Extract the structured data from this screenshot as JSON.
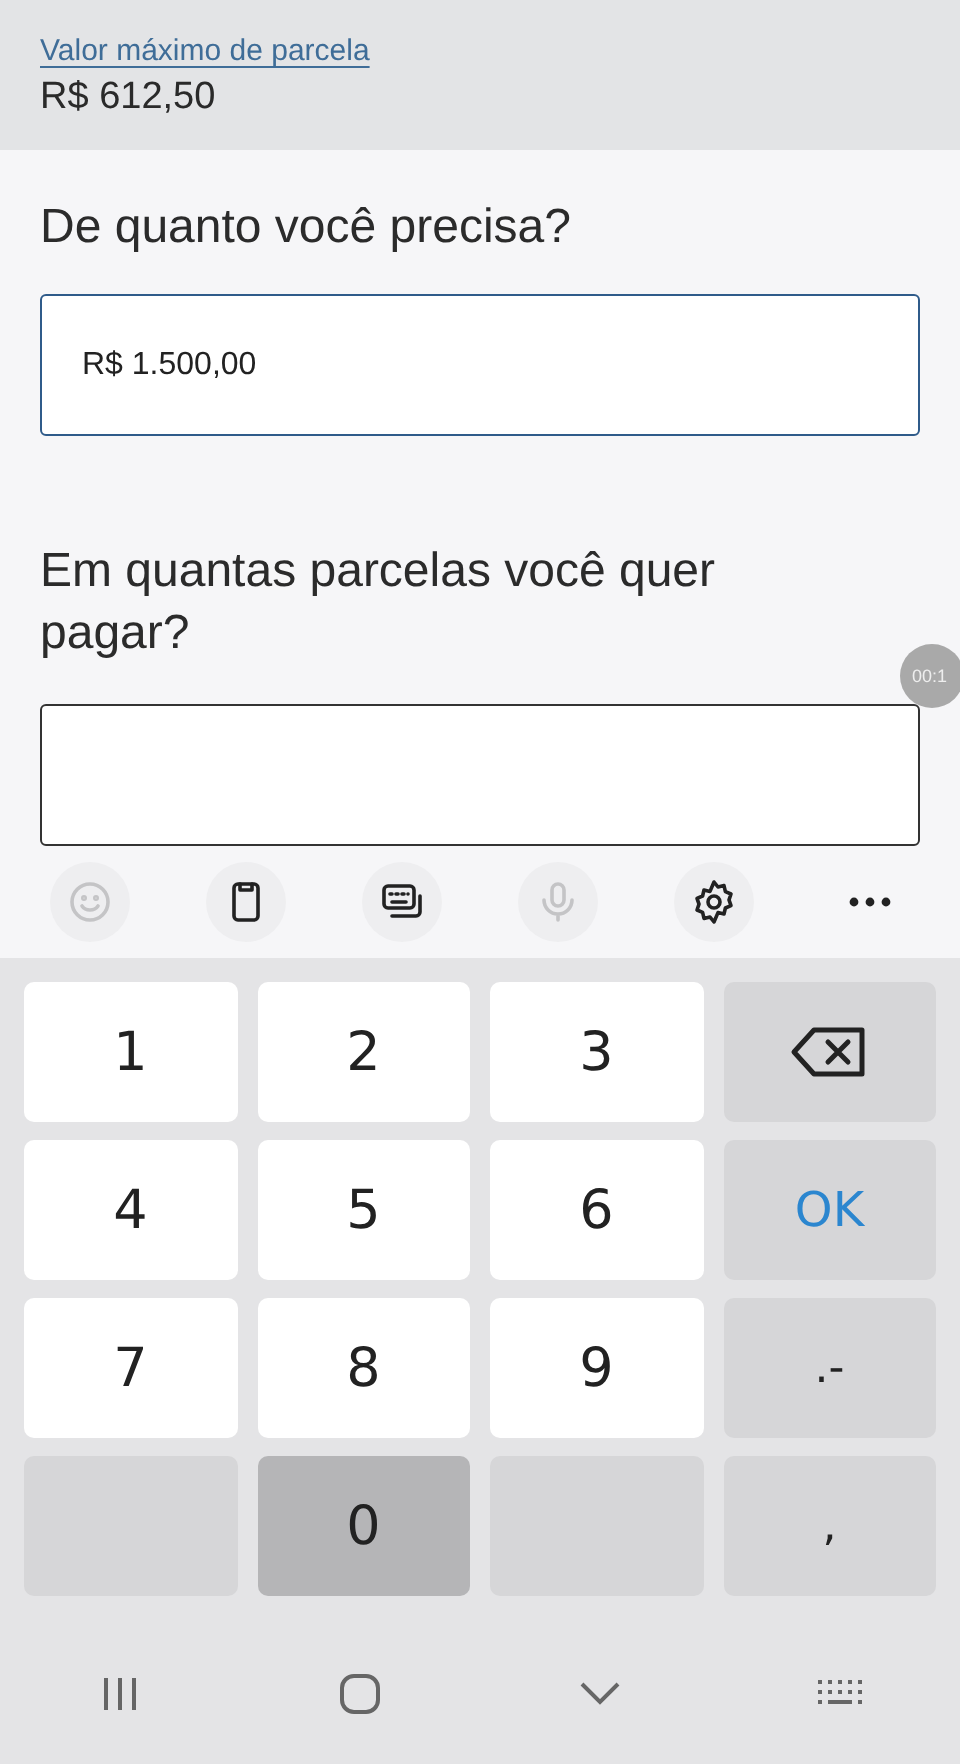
{
  "summary": {
    "link": "Valor máximo de parcela",
    "value": "R$ 612,50"
  },
  "amount": {
    "label": "De quanto você precisa?",
    "value": "R$ 1.500,00",
    "focused": true
  },
  "installments": {
    "label": "Em quantas parcelas você quer pagar?",
    "focused": false
  },
  "timer": "00:1",
  "toolbar": [
    {
      "kind": "emoji",
      "disabled": true
    },
    {
      "kind": "clipboard",
      "disabled": false
    },
    {
      "kind": "keyboard",
      "disabled": false
    },
    {
      "kind": "mic",
      "disabled": true
    },
    {
      "kind": "settings",
      "disabled": false
    },
    {
      "kind": "more",
      "disabled": false
    }
  ],
  "keys": [
    {
      "kind": "digit",
      "label": "1",
      "pressed": false
    },
    {
      "kind": "digit",
      "label": "2",
      "pressed": false
    },
    {
      "kind": "digit",
      "label": "3",
      "pressed": false
    },
    {
      "kind": "backspace",
      "pressed": false
    },
    {
      "kind": "digit",
      "label": "4",
      "pressed": false
    },
    {
      "kind": "digit",
      "label": "5",
      "pressed": false
    },
    {
      "kind": "digit",
      "label": "6",
      "pressed": false
    },
    {
      "kind": "ok",
      "label": "OK",
      "pressed": false
    },
    {
      "kind": "digit",
      "label": "7",
      "pressed": false
    },
    {
      "kind": "digit",
      "label": "8",
      "pressed": false
    },
    {
      "kind": "digit",
      "label": "9",
      "pressed": false
    },
    {
      "kind": "symbol",
      "label": ".-",
      "pressed": false
    },
    {
      "kind": "blank",
      "pressed": false
    },
    {
      "kind": "digit",
      "label": "0",
      "pressed": true
    },
    {
      "kind": "blank",
      "pressed": false
    },
    {
      "kind": "symbol",
      "label": ",",
      "pressed": false
    }
  ]
}
